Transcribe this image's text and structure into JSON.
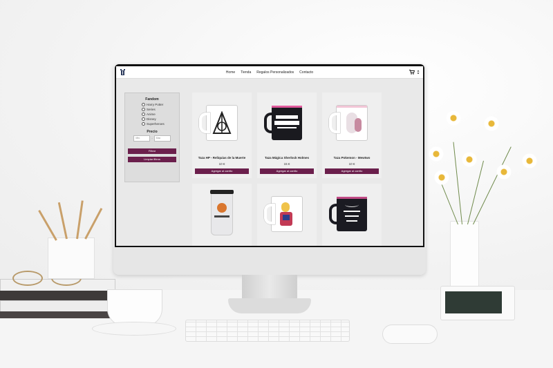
{
  "header": {
    "nav": [
      "Home",
      "Tienda",
      "Regalos Personalizados",
      "Contacto"
    ],
    "icons": [
      "logo-icon",
      "cart-icon",
      "more-icon"
    ]
  },
  "sidebar": {
    "fandom_title": "Fandom",
    "fandoms": [
      "Harry Potter",
      "Series",
      "Anime",
      "Disney",
      "Superheroes"
    ],
    "price_title": "Precio",
    "min_placeholder": "Min.",
    "max_placeholder": "Mac",
    "filter_label": "Filtrar",
    "clear_label": "Limpiar filtros"
  },
  "products": [
    {
      "title": "Taza HP - Reliquias de la Muerte",
      "price": "10 €",
      "button": "Agregar al carrito",
      "mug": "#ffffff",
      "inside": "#ffffff",
      "art": "#222222"
    },
    {
      "title": "Taza Mágica Sherlock Holmes",
      "price": "15 €",
      "button": "Agregar al carrito",
      "mug": "#1a1a1f",
      "inside": "#e05a9c",
      "art": "#ffffff"
    },
    {
      "title": "Taza Pokemon - Mewtwo",
      "price": "10 €",
      "button": "Agregar al carrito",
      "mug": "#ffffff",
      "inside": "#f2c6d6",
      "art": "#c78aa0"
    },
    {
      "title": "",
      "price": "",
      "button": "",
      "mug": "#e8e8ea",
      "inside": "#222222",
      "art": "#d9762e"
    },
    {
      "title": "",
      "price": "",
      "button": "",
      "mug": "#ffffff",
      "inside": "#ffffff",
      "art": "#c23a55"
    },
    {
      "title": "",
      "price": "",
      "button": "",
      "mug": "#1b1b22",
      "inside": "#c14b86",
      "art": "#ffffff"
    }
  ],
  "colors": {
    "accent": "#6b1f4c",
    "screen_bg": "#e9e9e9"
  }
}
